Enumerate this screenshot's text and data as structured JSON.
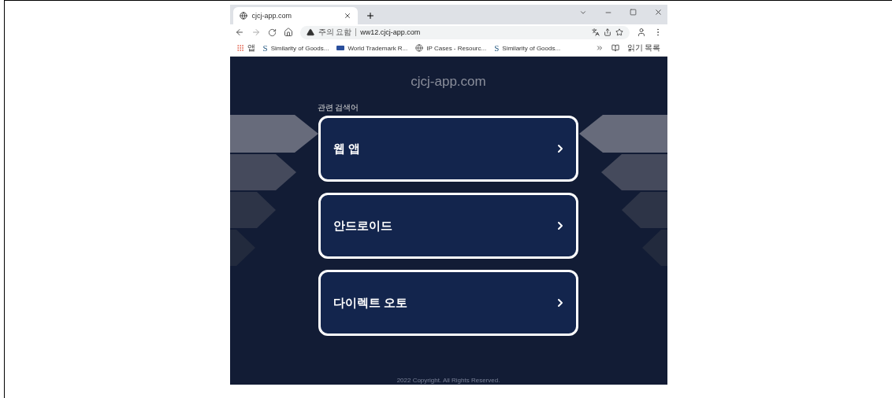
{
  "browser": {
    "tab": {
      "title": "cjcj-app.com"
    },
    "address_bar": {
      "security_label": "주의 요함",
      "url": "ww12.cjcj-app.com"
    },
    "bookmarks": [
      {
        "label": "앱",
        "kind": "apps"
      },
      {
        "label": "Similarity of Goods...",
        "kind": "s",
        "logo": "S"
      },
      {
        "label": "World Trademark R...",
        "kind": "wtm"
      },
      {
        "label": "IP Cases - Resourc...",
        "kind": "globe"
      },
      {
        "label": "Similarity of Goods...",
        "kind": "s",
        "logo": "S"
      }
    ],
    "reading_list": "읽기 목록"
  },
  "page": {
    "site_title": "cjcj-app.com",
    "related_label": "관련 검색어",
    "links": [
      {
        "label": "웹 앱"
      },
      {
        "label": "안드로이드"
      },
      {
        "label": "다이렉트 오토"
      }
    ],
    "footer": "2022 Copyright. All Rights Reserved."
  }
}
